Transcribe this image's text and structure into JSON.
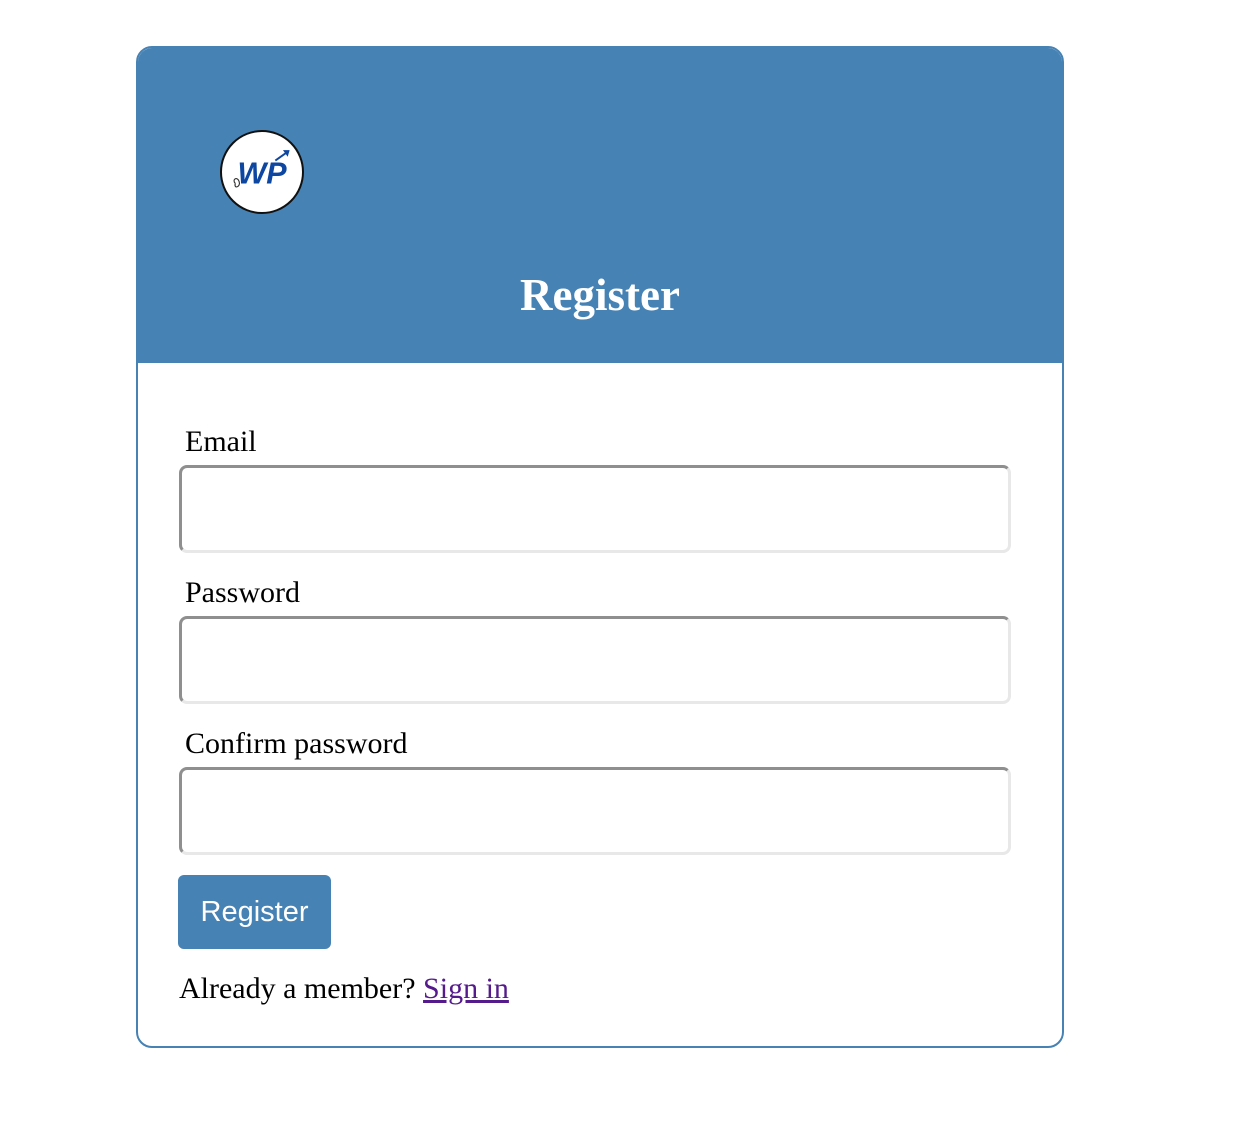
{
  "header": {
    "logo_text": "WP",
    "title": "Register"
  },
  "form": {
    "email_label": "Email",
    "email_value": "",
    "password_label": "Password",
    "password_value": "",
    "confirm_label": "Confirm password",
    "confirm_value": "",
    "submit_label": "Register"
  },
  "footer": {
    "prompt": "Already a member?",
    "link_label": "Sign in"
  },
  "colors": {
    "primary": "#4682b4",
    "link_visited": "#551a8b",
    "logo_blue": "#0d47a1"
  }
}
